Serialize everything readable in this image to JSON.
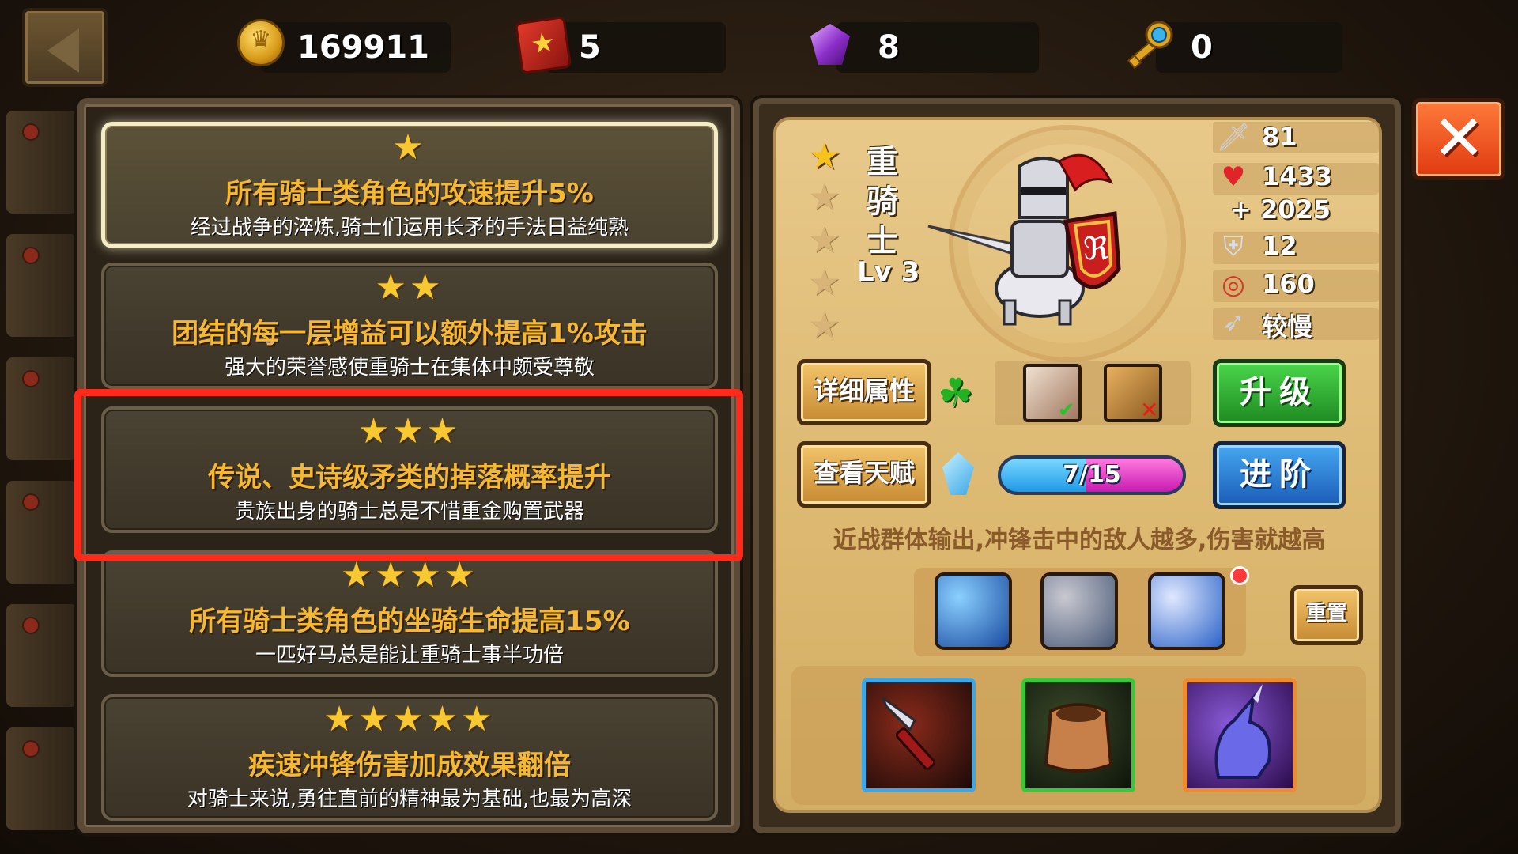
{
  "resources": {
    "gold": "169911",
    "tomes": "5",
    "gems": "8",
    "keys": "0"
  },
  "talents": [
    {
      "stars": "★",
      "title": "所有骑士类角色的攻速提升5%",
      "desc": "经过战争的淬炼,骑士们运用长矛的手法日益纯熟",
      "active": true
    },
    {
      "stars": "★★",
      "title": "团结的每一层增益可以额外提高1%攻击",
      "desc": "强大的荣誉感使重骑士在集体中颇受尊敬",
      "active": false
    },
    {
      "stars": "★★★",
      "title": "传说、史诗级矛类的掉落概率提升",
      "desc": "贵族出身的骑士总是不惜重金购置武器",
      "active": false
    },
    {
      "stars": "★★★★",
      "title": "所有骑士类角色的坐骑生命提高15%",
      "desc": "一匹好马总是能让重骑士事半功倍",
      "active": false
    },
    {
      "stars": "★★★★★",
      "title": "疾速冲锋伤害加成效果翻倍",
      "desc": "对骑士来说,勇往直前的精神最为基础,也最为高深",
      "active": false
    }
  ],
  "hero": {
    "name_chars": [
      "重",
      "骑",
      "士"
    ],
    "level": "Lv 3",
    "rank": 1,
    "rank_max": 5,
    "stats": {
      "attack": "81",
      "hp": "1433",
      "hp_bonus": "+ 2025",
      "armor": "12",
      "range": "160",
      "speed": "较慢"
    },
    "description": "近战群体输出,冲锋击中的敌人越多,伤害就越高",
    "progress": {
      "text": "7/15",
      "current": 7,
      "max": 15
    }
  },
  "buttons": {
    "details": "详细属性",
    "talents": "查看天赋",
    "upgrade": "升级",
    "advance": "进阶",
    "reset": "重置",
    "close": "✕",
    "back": "◀"
  },
  "icons": {
    "back": "back-arrow-icon",
    "gold": "gold-coin-icon",
    "tomes": "red-tome-icon",
    "gems": "purple-gem-icon",
    "keys": "blue-key-icon",
    "clover": "clover-icon",
    "crystal": "blue-crystal-icon",
    "attack": "sword-icon",
    "hp": "heart-icon",
    "armor": "armor-icon",
    "range": "target-icon",
    "speed": "boot-speed-icon"
  },
  "colors": {
    "talent_title": "#f5b830",
    "star": "#f7c832",
    "highlight": "#ff2a1a",
    "close_button": "#e03a10",
    "upgrade_button": "#1e8a22",
    "advance_button": "#1a5cb8"
  }
}
